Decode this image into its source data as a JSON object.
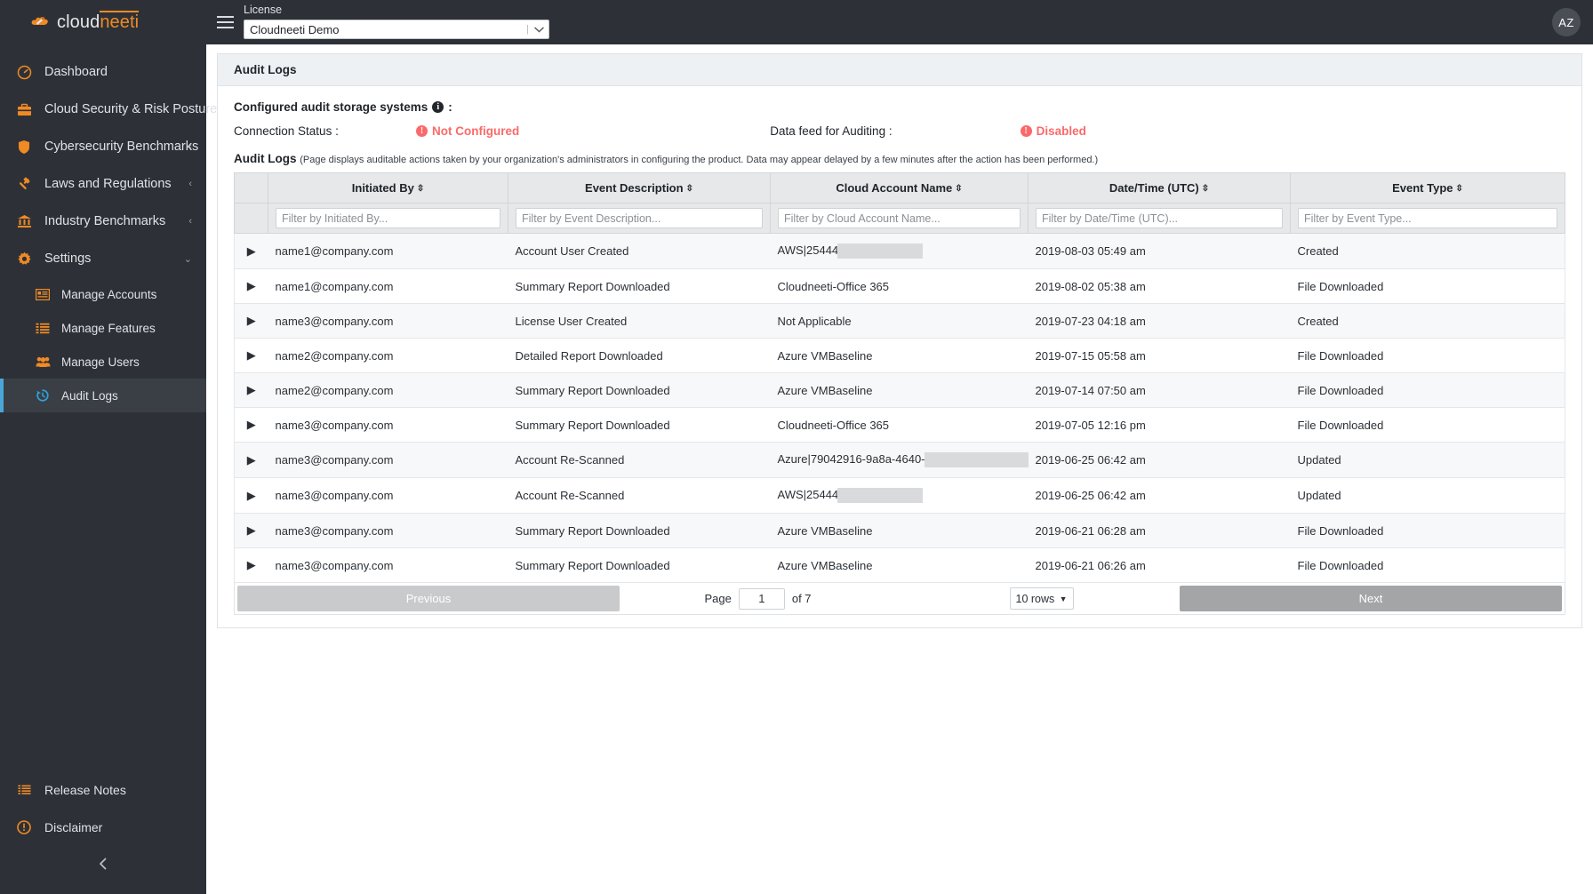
{
  "brand": {
    "part1": "cloud",
    "part2": "neeti",
    "logo_icon": "cloudneeti-logo-icon"
  },
  "topbar": {
    "menu_icon": "hamburger-icon",
    "license_label": "License",
    "license_value": "Cloudneeti Demo",
    "license_caret_icon": "chevron-down-icon",
    "avatar_initials": "AZ"
  },
  "sidebar": {
    "items": [
      {
        "label": "Dashboard",
        "icon": "gauge-icon",
        "chevron": ""
      },
      {
        "label": "Cloud Security & Risk Posture",
        "icon": "briefcase-icon",
        "chevron": ""
      },
      {
        "label": "Cybersecurity Benchmarks",
        "icon": "shield-icon",
        "chevron": "‹"
      },
      {
        "label": "Laws and Regulations",
        "icon": "gavel-icon",
        "chevron": "‹"
      },
      {
        "label": "Industry Benchmarks",
        "icon": "bank-icon",
        "chevron": "‹"
      },
      {
        "label": "Settings",
        "icon": "gear-icon",
        "chevron": "⌄"
      }
    ],
    "settings_children": [
      {
        "label": "Manage Accounts",
        "icon": "list-card-icon",
        "active": false
      },
      {
        "label": "Manage Features",
        "icon": "list-icon",
        "active": false
      },
      {
        "label": "Manage Users",
        "icon": "users-icon",
        "active": false
      },
      {
        "label": "Audit Logs",
        "icon": "history-clock-icon",
        "active": true
      }
    ],
    "bottom_items": [
      {
        "label": "Release Notes",
        "icon": "notes-icon"
      },
      {
        "label": "Disclaimer",
        "icon": "exclamation-circle-icon"
      }
    ],
    "collapse_icon": "chevron-left-icon"
  },
  "page": {
    "card_title": "Audit Logs",
    "configured_title": "Configured audit storage systems",
    "configured_info_icon": "info-icon",
    "configured_colon": ":",
    "connection_status_label": "Connection Status :",
    "connection_status_value": "Not Configured",
    "data_feed_label": "Data feed for Auditing :",
    "data_feed_value": "Disabled",
    "status_alert_icon": "exclamation-circle-icon",
    "logs_heading": "Audit Logs",
    "logs_description": "(Page displays auditable actions taken by your organization's administrators in configuring the product. Data may appear delayed by a few minutes after the action has been performed.)"
  },
  "table": {
    "sort_icon": "sort-updown-icon",
    "expand_icon": "caret-right-icon",
    "columns": [
      {
        "key": "initiated_by",
        "label": "Initiated By",
        "placeholder": "Filter by Initiated By..."
      },
      {
        "key": "event_description",
        "label": "Event Description",
        "placeholder": "Filter by Event Description..."
      },
      {
        "key": "cloud_account_name",
        "label": "Cloud Account Name",
        "placeholder": "Filter by Cloud Account Name..."
      },
      {
        "key": "datetime_utc",
        "label": "Date/Time (UTC)",
        "placeholder": "Filter by Date/Time (UTC)..."
      },
      {
        "key": "event_type",
        "label": "Event Type",
        "placeholder": "Filter by Event Type..."
      }
    ],
    "filter_values": [
      "",
      "",
      "",
      "",
      ""
    ],
    "rows": [
      {
        "initiated_by": "name1@company.com",
        "event_description": "Account User Created",
        "cloud_account_name": "AWS|25444",
        "redacted_width": 96,
        "datetime_utc": "2019-08-03 05:49 am",
        "event_type": "Created"
      },
      {
        "initiated_by": "name1@company.com",
        "event_description": "Summary Report Downloaded",
        "cloud_account_name": "Cloudneeti-Office 365",
        "redacted_width": 0,
        "datetime_utc": "2019-08-02 05:38 am",
        "event_type": "File Downloaded"
      },
      {
        "initiated_by": "name3@company.com",
        "event_description": "License User Created",
        "cloud_account_name": "Not Applicable",
        "redacted_width": 0,
        "datetime_utc": "2019-07-23 04:18 am",
        "event_type": "Created"
      },
      {
        "initiated_by": "name2@company.com",
        "event_description": "Detailed Report Downloaded",
        "cloud_account_name": "Azure VMBaseline",
        "redacted_width": 0,
        "datetime_utc": "2019-07-15 05:58 am",
        "event_type": "File Downloaded"
      },
      {
        "initiated_by": "name2@company.com",
        "event_description": "Summary Report Downloaded",
        "cloud_account_name": "Azure VMBaseline",
        "redacted_width": 0,
        "datetime_utc": "2019-07-14 07:50 am",
        "event_type": "File Downloaded"
      },
      {
        "initiated_by": "name3@company.com",
        "event_description": "Summary Report Downloaded",
        "cloud_account_name": "Cloudneeti-Office 365",
        "redacted_width": 0,
        "datetime_utc": "2019-07-05 12:16 pm",
        "event_type": "File Downloaded"
      },
      {
        "initiated_by": "name3@company.com",
        "event_description": "Account Re-Scanned",
        "cloud_account_name": "Azure|79042916-9a8a-4640-",
        "redacted_width": 117,
        "datetime_utc": "2019-06-25 06:42 am",
        "event_type": "Updated"
      },
      {
        "initiated_by": "name3@company.com",
        "event_description": "Account Re-Scanned",
        "cloud_account_name": "AWS|25444",
        "redacted_width": 96,
        "datetime_utc": "2019-06-25 06:42 am",
        "event_type": "Updated"
      },
      {
        "initiated_by": "name3@company.com",
        "event_description": "Summary Report Downloaded",
        "cloud_account_name": "Azure VMBaseline",
        "redacted_width": 0,
        "datetime_utc": "2019-06-21 06:28 am",
        "event_type": "File Downloaded"
      },
      {
        "initiated_by": "name3@company.com",
        "event_description": "Summary Report Downloaded",
        "cloud_account_name": "Azure VMBaseline",
        "redacted_width": 0,
        "datetime_utc": "2019-06-21 06:26 am",
        "event_type": "File Downloaded"
      }
    ]
  },
  "pagination": {
    "previous_label": "Previous",
    "next_label": "Next",
    "page_label": "Page",
    "page_value": "1",
    "of_label": "of 7",
    "rows_per_page": "10 rows",
    "rows_caret_icon": "caret-down-icon"
  },
  "colors": {
    "sidebar_bg": "#2d3137",
    "accent_orange": "#f08a24",
    "status_red": "#fa6a6a",
    "active_blue": "#2ea3dd"
  }
}
